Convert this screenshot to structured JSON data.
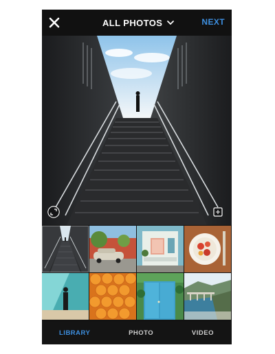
{
  "header": {
    "title": "ALL PHOTOS",
    "next_label": "NEXT"
  },
  "icons": {
    "close": "close-icon",
    "title_dropdown": "chevron-down-icon",
    "expand": "expand-icon",
    "multi_select": "multi-select-icon"
  },
  "colors": {
    "accent": "#3d8fe0",
    "background": "#121212"
  },
  "library": {
    "thumbnails": [
      {
        "subject": "staircase",
        "selected": true
      },
      {
        "subject": "red-wall-car",
        "selected": false
      },
      {
        "subject": "storefront",
        "selected": false
      },
      {
        "subject": "food-plate",
        "selected": false
      },
      {
        "subject": "person-teal-wall",
        "selected": false
      },
      {
        "subject": "oranges",
        "selected": false
      },
      {
        "subject": "blue-door",
        "selected": false
      },
      {
        "subject": "coast",
        "selected": false
      }
    ]
  },
  "tabs": [
    {
      "label": "LIBRARY",
      "active": true
    },
    {
      "label": "PHOTO",
      "active": false
    },
    {
      "label": "VIDEO",
      "active": false
    }
  ]
}
